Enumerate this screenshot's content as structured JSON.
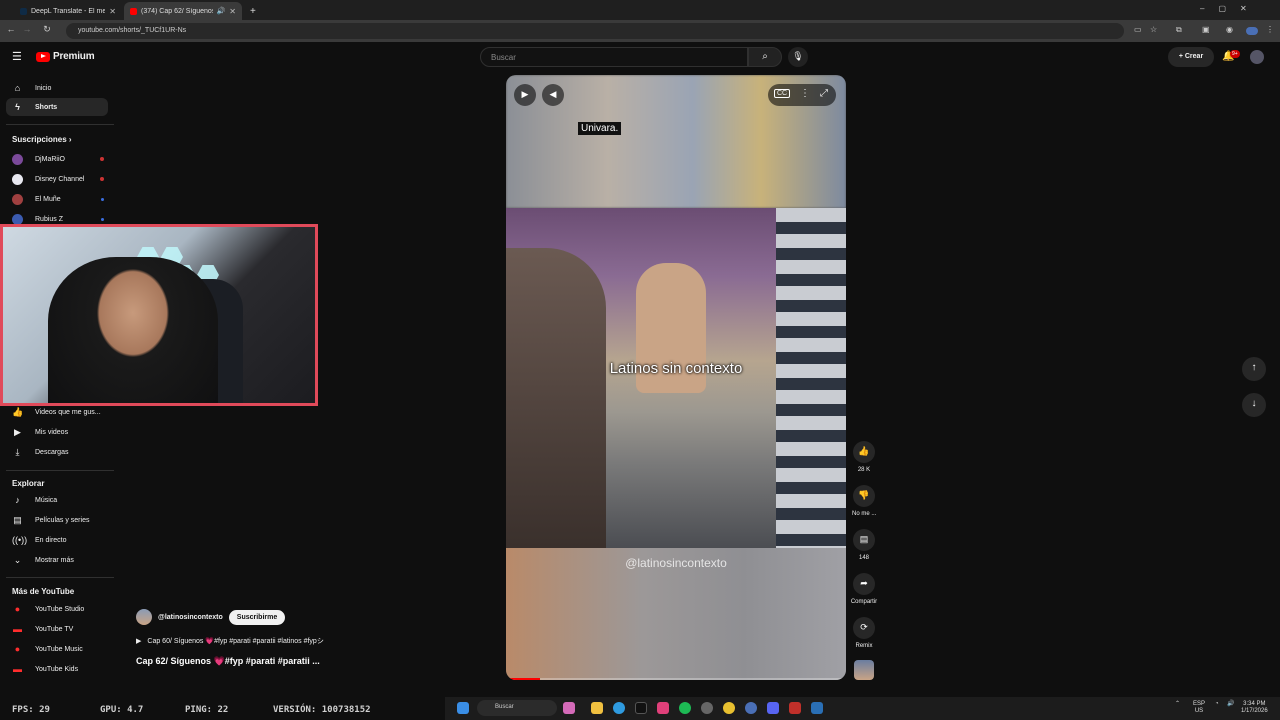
{
  "browser": {
    "tabs": [
      {
        "title": "DeepL Translate - El mejor traductor",
        "favicon_color": "#0f2b46"
      },
      {
        "title": "(374) Cap 62/ Síguenos",
        "favicon_color": "#ff0000"
      }
    ],
    "url": "youtube.com/shorts/_TUCf1UR-Ns"
  },
  "header": {
    "logo_text": "Premium",
    "search_placeholder": "Buscar",
    "create_label": "Crear",
    "notif_badge": "9+"
  },
  "sidebar": {
    "main": [
      {
        "label": "Inicio",
        "icon": "home-icon"
      },
      {
        "label": "Shorts",
        "icon": "shorts-icon"
      }
    ],
    "subscriptions_heading": "Suscripciones",
    "subscriptions": [
      {
        "label": "DjMaRiiO",
        "color": "#7b4a9a"
      },
      {
        "label": "Disney Channel",
        "color": "#e8e8f0"
      },
      {
        "label": "El Muñe",
        "color": "#a04040"
      },
      {
        "label": "Rubius Z",
        "color": "#3b5bb0"
      }
    ],
    "you": [
      {
        "label": "Videos que me gustaron",
        "display": "Videos que me gus...",
        "icon": "thumb-up-icon"
      },
      {
        "label": "Mis videos",
        "icon": "video-icon"
      },
      {
        "label": "Descargas",
        "icon": "download-icon"
      }
    ],
    "explore_heading": "Explorar",
    "explore": [
      {
        "label": "Música",
        "icon": "music-icon"
      },
      {
        "label": "Películas y series",
        "icon": "film-icon"
      },
      {
        "label": "En directo",
        "icon": "live-icon"
      },
      {
        "label": "Mostrar más",
        "icon": "chevron-down-icon"
      }
    ],
    "more_heading": "Más de YouTube",
    "more": [
      {
        "label": "YouTube Studio"
      },
      {
        "label": "YouTube TV"
      },
      {
        "label": "YouTube Music"
      },
      {
        "label": "YouTube Kids"
      }
    ]
  },
  "short": {
    "subtitle_top": "Univara.",
    "caption": "Latinos sin contexto",
    "watermark": "@latinosincontexto",
    "progress": 0.1
  },
  "actions": {
    "likes": "28 K",
    "dislike_label": "No me ...",
    "comments": "148",
    "share_label": "Compartir",
    "remix_label": "Remix"
  },
  "channel": {
    "name": "@latinosincontexto",
    "subscribe_label": "Suscribirme",
    "playlist_text": "Cap 60/ Síguenos 💗#fyp #parati #paratii #latinos #fypシ",
    "title": "Cap 62/ Síguenos 💗#fyp #parati #paratii ..."
  },
  "overlay_stats": {
    "fps": "FPS: 29",
    "gpu": "GPU: 4.7",
    "ping": "PING: 22",
    "version": "VERSIÓN: 100738152"
  },
  "taskbar": {
    "search_label": "Buscar",
    "lang": "ESP",
    "lang_sub": "US",
    "time": "3:34 PM",
    "date": "1/17/2026"
  }
}
